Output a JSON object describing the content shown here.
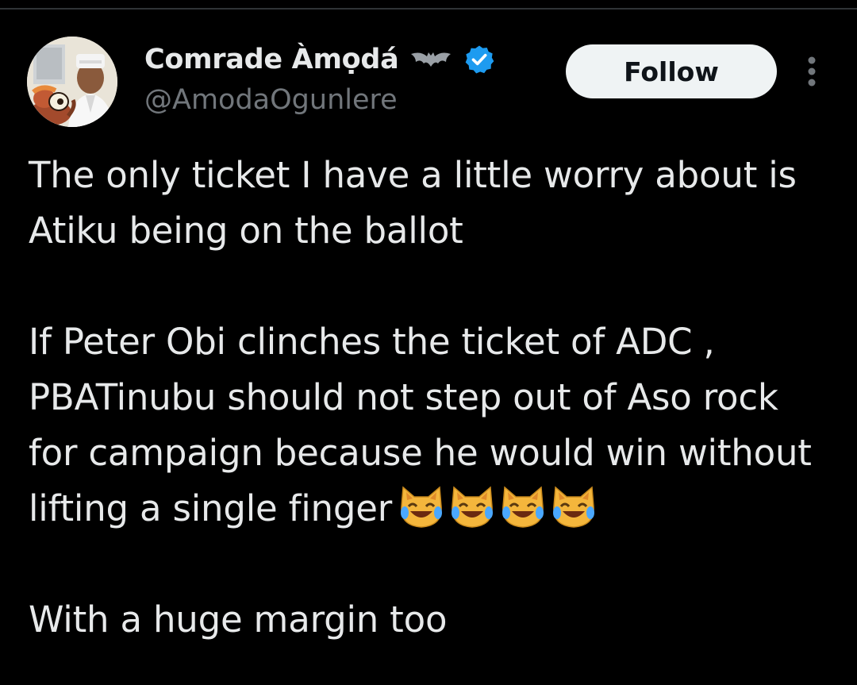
{
  "author": {
    "display_name": "Comrade Àmọdá",
    "handle": "@AmodaOgunlere",
    "verified": true,
    "name_decoration_icon": "bat-icon",
    "verified_badge_color": "#1d9bf0"
  },
  "actions": {
    "follow_label": "Follow",
    "more_icon": "more-vertical-icon"
  },
  "tweet": {
    "paragraphs": [
      "The only ticket I have a little worry about is Atiku being on the ballot",
      "If Peter Obi clinches the ticket of ADC , PBATinubu should not step out of Aso rock for campaign because he would win without lifting a single finger",
      "With a huge margin too"
    ],
    "emoji_after_paragraph_2": {
      "icon": "cat-tears-of-joy-icon",
      "count": 4
    }
  },
  "colors": {
    "background": "#000000",
    "text_primary": "#e7e9ea",
    "text_secondary": "#71767b",
    "follow_button_bg": "#eff3f4",
    "divider": "#2f3336"
  }
}
